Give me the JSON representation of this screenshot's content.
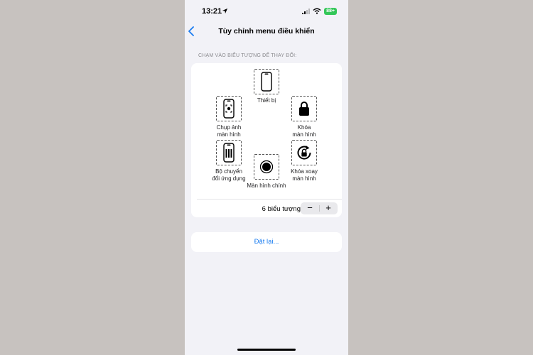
{
  "status_bar": {
    "time": "13:21",
    "battery": "88+",
    "icons": [
      "location-arrow-icon",
      "cellular-signal-icon",
      "wifi-icon",
      "battery-icon"
    ]
  },
  "nav": {
    "back_icon": "chevron-left-icon",
    "title": "Tùy chỉnh menu điều khiển"
  },
  "section_header": "CHẠM VÀO BIỂU TƯỢNG ĐỂ THAY ĐỔI:",
  "icons": [
    {
      "label": "Thiết bị",
      "icon": "device-phone-icon"
    },
    {
      "label": "Chụp ảnh\nmàn hình",
      "icon": "screenshot-icon"
    },
    {
      "label": "Khóa\nmàn hình",
      "icon": "lock-icon"
    },
    {
      "label": "Bộ chuyển\nđổi ứng dụng",
      "icon": "app-switcher-icon"
    },
    {
      "label": "Khóa xoay\nmàn hình",
      "icon": "rotation-lock-icon"
    },
    {
      "label": "Màn hình chính",
      "icon": "home-button-icon"
    }
  ],
  "stepper": {
    "count_label": "6 biểu tượng",
    "minus": "−",
    "plus": "+"
  },
  "reset_label": "Đặt lại...",
  "colors": {
    "accent": "#1a7cf0",
    "background": "#f2f2f7",
    "outer_background": "#c7c2bf",
    "battery": "#34c759"
  }
}
